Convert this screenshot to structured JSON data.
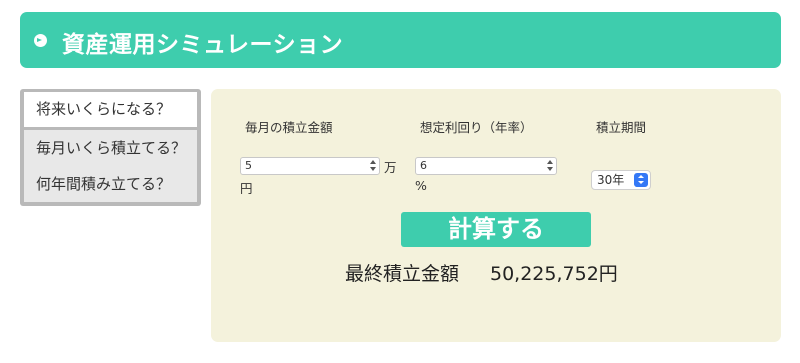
{
  "header": {
    "title": "資産運用シミュレーション",
    "icon": "chevron-circle-right-icon"
  },
  "tabs": [
    {
      "label": "将来いくらになる？",
      "active": true
    },
    {
      "label": "毎月いくら積立てる？",
      "active": false
    },
    {
      "label": "何年間積み立てる？",
      "active": false
    }
  ],
  "form": {
    "monthly": {
      "label": "毎月の積立金額",
      "value": "5",
      "unit_a": "万",
      "unit_b": "円"
    },
    "rate": {
      "label": "想定利回り（年率）",
      "value": "6",
      "unit": "%"
    },
    "period": {
      "label": "積立期間",
      "selected": "30年"
    }
  },
  "calc_button": "計算する",
  "result": {
    "label": "最終積立金額",
    "value": "50,225,752円"
  },
  "colors": {
    "accent": "#3ecdad",
    "panel": "#f4f2dc",
    "tab_frame": "#b9b9b9"
  }
}
